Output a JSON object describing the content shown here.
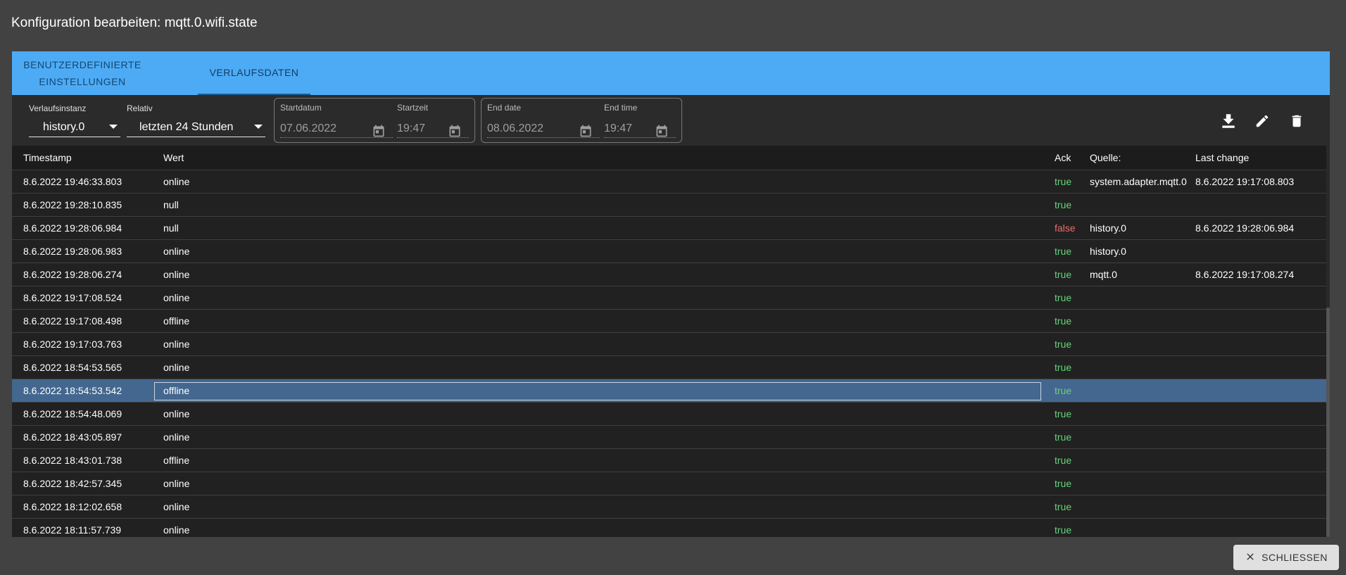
{
  "dialog": {
    "title": "Konfiguration bearbeiten: mqtt.0.wifi.state"
  },
  "tabs": [
    {
      "label_line1": "BENUTZERDEFINIERTE",
      "label_line2": "EINSTELLUNGEN"
    },
    {
      "label": "VERLAUFSDATEN"
    }
  ],
  "toolbar": {
    "instance": {
      "label": "Verlaufsinstanz",
      "value": "history.0"
    },
    "relative": {
      "label": "Relativ",
      "value": "letzten 24 Stunden"
    },
    "start": {
      "date_label": "Startdatum",
      "date_value": "07.06.2022",
      "time_label": "Startzeit",
      "time_value": "19:47"
    },
    "end": {
      "date_label": "End date",
      "date_value": "08.06.2022",
      "time_label": "End time",
      "time_value": "19:47"
    },
    "icons": [
      "download-icon",
      "edit-icon",
      "delete-icon"
    ]
  },
  "table": {
    "headers": {
      "timestamp": "Timestamp",
      "value": "Wert",
      "ack": "Ack",
      "source": "Quelle:",
      "last_change": "Last change"
    },
    "rows": [
      {
        "ts": "8.6.2022 19:46:33.803",
        "val": "online",
        "ack": "true",
        "src": "system.adapter.mqtt.0",
        "lc": "8.6.2022 19:17:08.803"
      },
      {
        "ts": "8.6.2022 19:28:10.835",
        "val": "null",
        "ack": "true",
        "src": "",
        "lc": ""
      },
      {
        "ts": "8.6.2022 19:28:06.984",
        "val": "null",
        "ack": "false",
        "src": "history.0",
        "lc": "8.6.2022 19:28:06.984"
      },
      {
        "ts": "8.6.2022 19:28:06.983",
        "val": "online",
        "ack": "true",
        "src": "history.0",
        "lc": ""
      },
      {
        "ts": "8.6.2022 19:28:06.274",
        "val": "online",
        "ack": "true",
        "src": "mqtt.0",
        "lc": "8.6.2022 19:17:08.274"
      },
      {
        "ts": "8.6.2022 19:17:08.524",
        "val": "online",
        "ack": "true",
        "src": "",
        "lc": ""
      },
      {
        "ts": "8.6.2022 19:17:08.498",
        "val": "offline",
        "ack": "true",
        "src": "",
        "lc": ""
      },
      {
        "ts": "8.6.2022 19:17:03.763",
        "val": "online",
        "ack": "true",
        "src": "",
        "lc": ""
      },
      {
        "ts": "8.6.2022 18:54:53.565",
        "val": "online",
        "ack": "true",
        "src": "",
        "lc": ""
      },
      {
        "ts": "8.6.2022 18:54:53.542",
        "val": "offline",
        "ack": "true",
        "src": "",
        "lc": "",
        "selected": true
      },
      {
        "ts": "8.6.2022 18:54:48.069",
        "val": "online",
        "ack": "true",
        "src": "",
        "lc": ""
      },
      {
        "ts": "8.6.2022 18:43:05.897",
        "val": "online",
        "ack": "true",
        "src": "",
        "lc": ""
      },
      {
        "ts": "8.6.2022 18:43:01.738",
        "val": "offline",
        "ack": "true",
        "src": "",
        "lc": ""
      },
      {
        "ts": "8.6.2022 18:42:57.345",
        "val": "online",
        "ack": "true",
        "src": "",
        "lc": ""
      },
      {
        "ts": "8.6.2022 18:12:02.658",
        "val": "online",
        "ack": "true",
        "src": "",
        "lc": ""
      },
      {
        "ts": "8.6.2022 18:11:57.739",
        "val": "online",
        "ack": "true",
        "src": "",
        "lc": ""
      }
    ]
  },
  "footer": {
    "close_label": "SCHLIESSEN"
  },
  "colors": {
    "tab_bar": "#4dabf5",
    "ack_true": "#66d27a",
    "ack_false": "#ef6a6a",
    "selected_row": "#43678f"
  }
}
